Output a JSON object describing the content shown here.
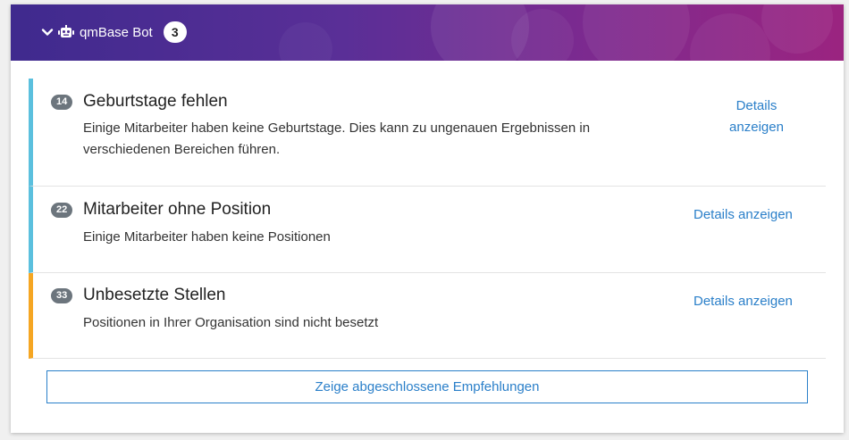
{
  "header": {
    "title": "qmBase Bot",
    "count": "3",
    "chevron_icon": "chevron-down-icon",
    "robot_icon": "robot-icon"
  },
  "items": [
    {
      "badge": "14",
      "title": "Geburtstage fehlen",
      "description": "Einige Mitarbeiter haben keine Geburtstage. Dies kann zu ungenauen Ergebnissen in verschiedenen Bereichen führen.",
      "details_label": "Details anzeigen",
      "status_color": "#5bc0de"
    },
    {
      "badge": "22",
      "title": "Mitarbeiter ohne Position",
      "description": "Einige Mitarbeiter haben keine Positionen",
      "details_label": "Details anzeigen",
      "status_color": "#5bc0de"
    },
    {
      "badge": "33",
      "title": "Unbesetzte Stellen",
      "description": "Positionen in Ihrer Organisation sind nicht besetzt",
      "details_label": "Details anzeigen",
      "status_color": "#f5a623"
    }
  ],
  "footer": {
    "show_completed_label": "Zeige abgeschlossene Empfehlungen"
  },
  "colors": {
    "link": "#2a7fc9",
    "header_gradient_start": "#3f2a8e",
    "header_gradient_end": "#9b2480"
  }
}
